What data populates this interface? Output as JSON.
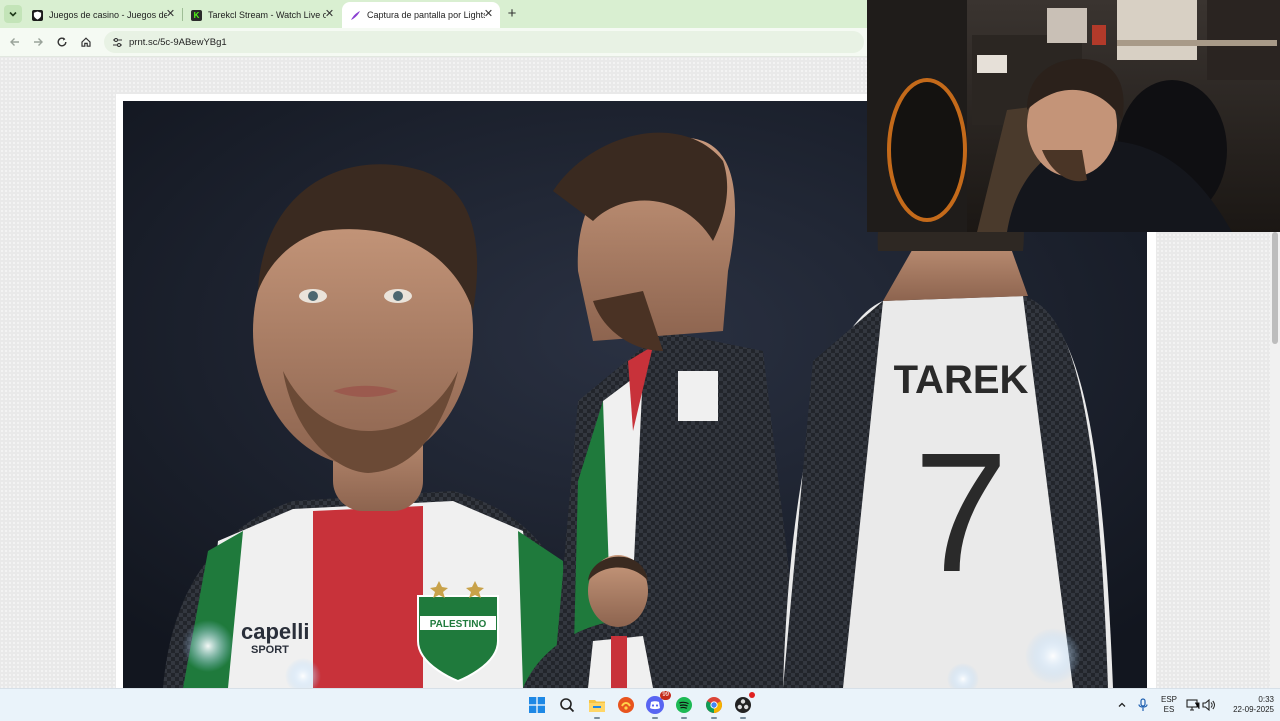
{
  "browser": {
    "tabs": [
      {
        "title": "Juegos de casino - Juegos de c",
        "active": false,
        "favicon": "casino-shield-icon"
      },
      {
        "title": "Tarekcl Stream - Watch Live on",
        "active": false,
        "favicon": "kick-icon"
      },
      {
        "title": "Captura de pantalla por Lightsh",
        "active": true,
        "favicon": "lightshot-feather-icon"
      }
    ],
    "url": "prnt.sc/5c-9ABewYBg1"
  },
  "screenshot_content": {
    "jersey_name": "TAREK",
    "jersey_number": "7",
    "sponsor": "capelli",
    "sponsor_sub": "SPORT",
    "badge_text": "PALESTINO",
    "colors": {
      "green": "#1f7a3c",
      "red": "#c8323a",
      "white": "#f2f2f2",
      "dark": "#1c2230"
    }
  },
  "taskbar": {
    "apps": [
      "windows-start-icon",
      "search-icon",
      "file-explorer-icon",
      "app-orange-icon",
      "discord-icon",
      "spotify-icon",
      "chrome-icon",
      "obs-icon"
    ],
    "discord_badge": "99",
    "language_top": "ESP",
    "language_bottom": "ES",
    "time": "0:33",
    "date": "22-09-2025"
  }
}
